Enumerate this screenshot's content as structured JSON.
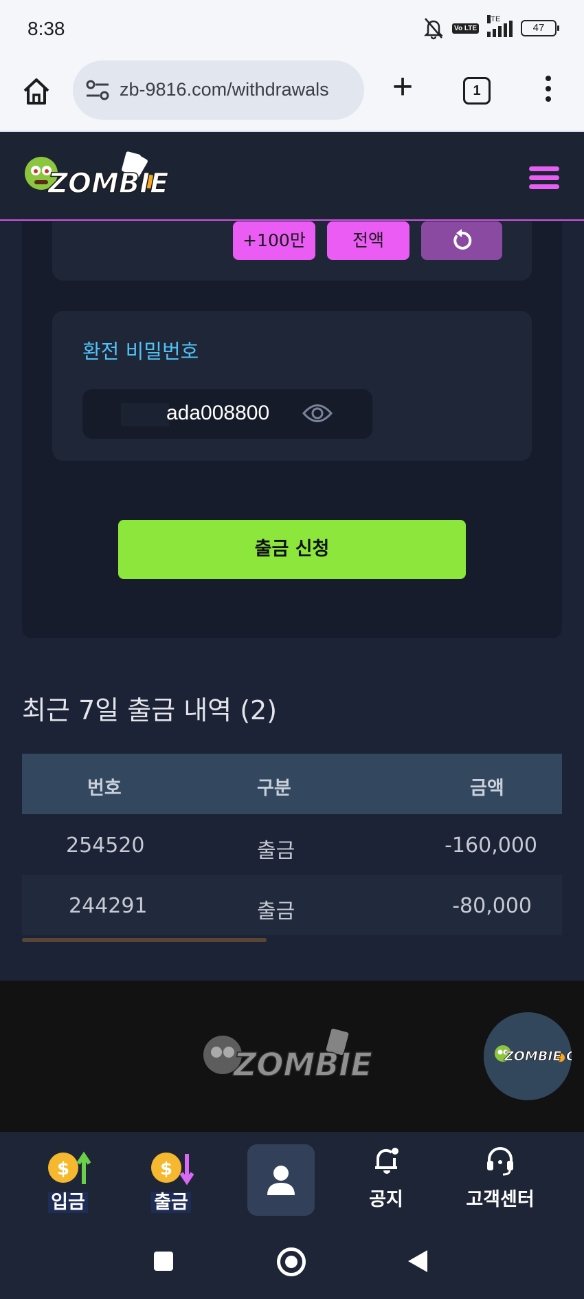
{
  "status_bar": {
    "time": "8:38",
    "volte": "Vo LTE",
    "network": "LTE",
    "battery": "47"
  },
  "browser": {
    "url": "zb-9816.com/withdrawals",
    "tab_count": "1"
  },
  "site": {
    "logo_alt": "ZOMBIE CASINO",
    "accent_color": "#e65ef2"
  },
  "amount_buttons": {
    "add_1m": "+100만",
    "all": "전액"
  },
  "password": {
    "label": "환전 비밀번호",
    "value": "ada008800"
  },
  "submit_label": "출금 신청",
  "history": {
    "title": "최근 7일 출금 내역 (2)",
    "columns": [
      "번호",
      "구분",
      "금액"
    ],
    "rows": [
      {
        "id": "254520",
        "type": "출금",
        "amount": "-160,000"
      },
      {
        "id": "244291",
        "type": "출금",
        "amount": "-80,000"
      }
    ]
  },
  "bottom_nav": {
    "deposit": "입금",
    "withdraw": "출금",
    "notice": "공지",
    "support": "고객센터"
  }
}
